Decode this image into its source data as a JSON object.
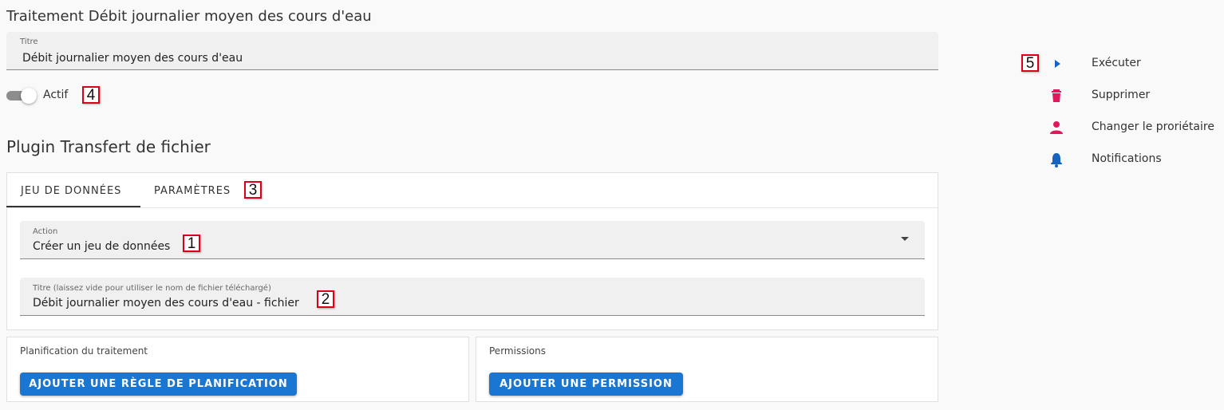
{
  "page": {
    "title": "Traitement Débit journalier moyen des cours d'eau"
  },
  "title_field": {
    "label": "Titre",
    "value": "Débit journalier moyen des cours d'eau"
  },
  "active_toggle": {
    "label": "Actif",
    "on": true
  },
  "plugin": {
    "title": "Plugin Transfert de fichier",
    "tabs": [
      {
        "label": "JEU DE DONNÉES",
        "selected": true
      },
      {
        "label": "PARAMÈTRES",
        "selected": false
      }
    ],
    "action_field": {
      "label": "Action",
      "value": "Créer un jeu de données"
    },
    "titre_field": {
      "label": "Titre (laissez vide pour utiliser le nom de fichier téléchargé)",
      "value": "Débit journalier moyen des cours d'eau - fichier"
    }
  },
  "planification": {
    "label": "Planification du traitement",
    "button": "AJOUTER UNE RÈGLE DE PLANIFICATION"
  },
  "permissions": {
    "label": "Permissions",
    "button": "AJOUTER UNE PERMISSION"
  },
  "actions": [
    {
      "label": "Exécuter",
      "icon": "play-icon",
      "color": "#1565c0"
    },
    {
      "label": "Supprimer",
      "icon": "trash-icon",
      "color": "#e0195a"
    },
    {
      "label": "Changer le proriétaire",
      "icon": "person-icon",
      "color": "#e0195a"
    },
    {
      "label": "Notifications",
      "icon": "bell-icon",
      "color": "#1565c0"
    }
  ],
  "callouts": [
    "1",
    "2",
    "3",
    "4",
    "5"
  ],
  "colors": {
    "primary": "#1976d2",
    "accent": "#e0195a",
    "callout_border": "#d9001b"
  }
}
